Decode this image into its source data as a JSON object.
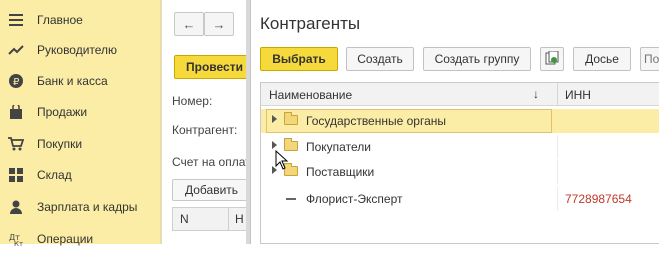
{
  "sidebar": {
    "items": [
      {
        "label": "Главное",
        "icon": "menu-icon"
      },
      {
        "label": "Руководителю",
        "icon": "trend-icon"
      },
      {
        "label": "Банк и касса",
        "icon": "ruble-coin-icon"
      },
      {
        "label": "Продажи",
        "icon": "shopping-bag-icon"
      },
      {
        "label": "Покупки",
        "icon": "cart-icon"
      },
      {
        "label": "Склад",
        "icon": "warehouse-icon"
      },
      {
        "label": "Зарплата и кадры",
        "icon": "person-icon"
      },
      {
        "label": "Операции",
        "icon": "operations-icon"
      }
    ]
  },
  "document": {
    "back_label": "←",
    "forward_label": "→",
    "post_button": "Провести",
    "number_label": "Номер:",
    "counterparty_label": "Контрагент:",
    "invoice_label": "Счет на оплат",
    "add_button": "Добавить",
    "grid_col_n": "N",
    "grid_col_h": "Н"
  },
  "popup": {
    "title": "Контрагенты",
    "buttons": {
      "select": "Выбрать",
      "create": "Создать",
      "create_group": "Создать группу",
      "dossier": "Досье",
      "more": "По"
    },
    "columns": {
      "name": "Наименование",
      "sort_arrow": "↓",
      "inn": "ИНН"
    },
    "rows": [
      {
        "name": "Государственные органы",
        "type": "group",
        "inn": ""
      },
      {
        "name": "Покупатели",
        "type": "group",
        "inn": ""
      },
      {
        "name": "Поставщики",
        "type": "group",
        "inn": ""
      },
      {
        "name": "Флорист-Эксперт",
        "type": "item",
        "inn": "7728987654"
      }
    ]
  },
  "colors": {
    "sidebar_bg": "#fbeda5",
    "primary_button": "#f6d93a",
    "inn_text": "#c0392b"
  }
}
